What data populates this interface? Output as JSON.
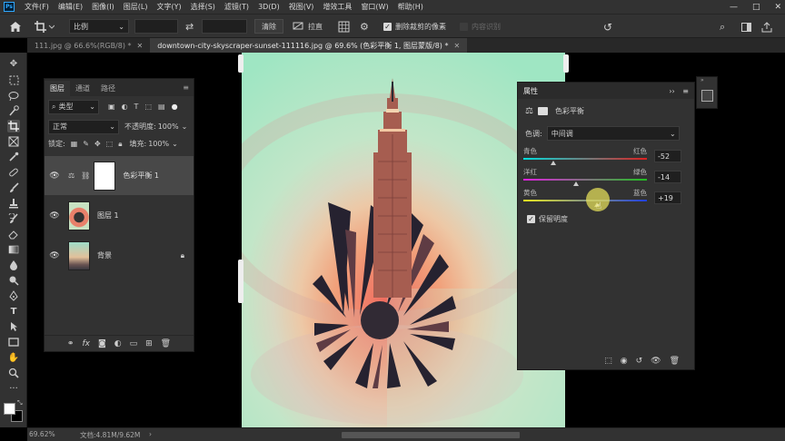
{
  "menu": {
    "logo": "Ps",
    "items": [
      "文件(F)",
      "编辑(E)",
      "图像(I)",
      "图层(L)",
      "文字(Y)",
      "选择(S)",
      "滤镜(T)",
      "3D(D)",
      "视图(V)",
      "增效工具",
      "窗口(W)",
      "帮助(H)"
    ]
  },
  "window_controls": [
    "—",
    "□",
    "✕"
  ],
  "options": {
    "ratio_label": "比例",
    "clear_label": "清除",
    "straighten_label": "拉直",
    "delete_cropped_label": "删除裁剪的像素",
    "content_aware_label": "内容识别"
  },
  "tabs": [
    {
      "label": "111.jpg @ 66.6%(RGB/8) *",
      "active": false
    },
    {
      "label": "downtown-city-skyscraper-sunset-111116.jpg @ 69.6% (色彩平衡 1, 图层蒙版/8) *",
      "active": true
    }
  ],
  "layers_panel": {
    "tabs": [
      "图层",
      "通道",
      "路径"
    ],
    "filter_label": "类型",
    "blend_mode": "正常",
    "opacity_label": "不透明度:",
    "opacity_value": "100%",
    "lock_label": "锁定:",
    "fill_label": "填充:",
    "fill_value": "100%",
    "layers": [
      {
        "name": "色彩平衡 1",
        "selected": true
      },
      {
        "name": "图层 1",
        "selected": false
      },
      {
        "name": "背景",
        "selected": false
      }
    ]
  },
  "properties_panel": {
    "title": "属性",
    "subtitle": "色彩平衡",
    "tone_label": "色调:",
    "tone_value": "中间调",
    "sliders": [
      {
        "left": "青色",
        "right": "红色",
        "value": -52
      },
      {
        "left": "洋红",
        "right": "绿色",
        "value": -14
      },
      {
        "left": "黄色",
        "right": "蓝色",
        "value": 19
      }
    ],
    "preserve_label": "保留明度",
    "preserve_checked": true
  },
  "status": {
    "zoom": "69.62%",
    "doc": "文档:4.81M/9.62M"
  },
  "colors": {
    "panel_bg": "#323232",
    "canvas_mint": "#b6e6c4",
    "canvas_orange": "#f2a57c",
    "accent_blue": "#31a8ff"
  }
}
